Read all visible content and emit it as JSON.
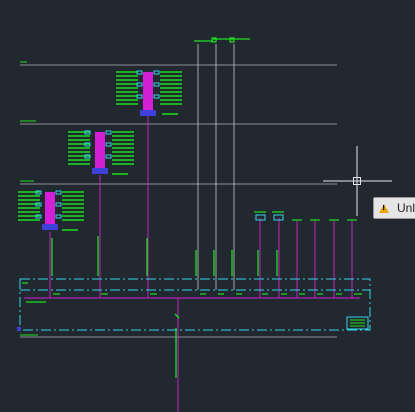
{
  "tooltip": {
    "text": "Unl",
    "icon": "warning-icon"
  },
  "colors": {
    "background": "#212830",
    "green": "#1ee01e",
    "magenta": "#d51fd5",
    "white_line": "#b4b4b4",
    "cyan": "#35d4e8",
    "blue": "#3f3fd9",
    "tooltip_bg": "#e6e6e6"
  },
  "crosshair": {
    "icon": "crosshair-cursor-icon"
  }
}
